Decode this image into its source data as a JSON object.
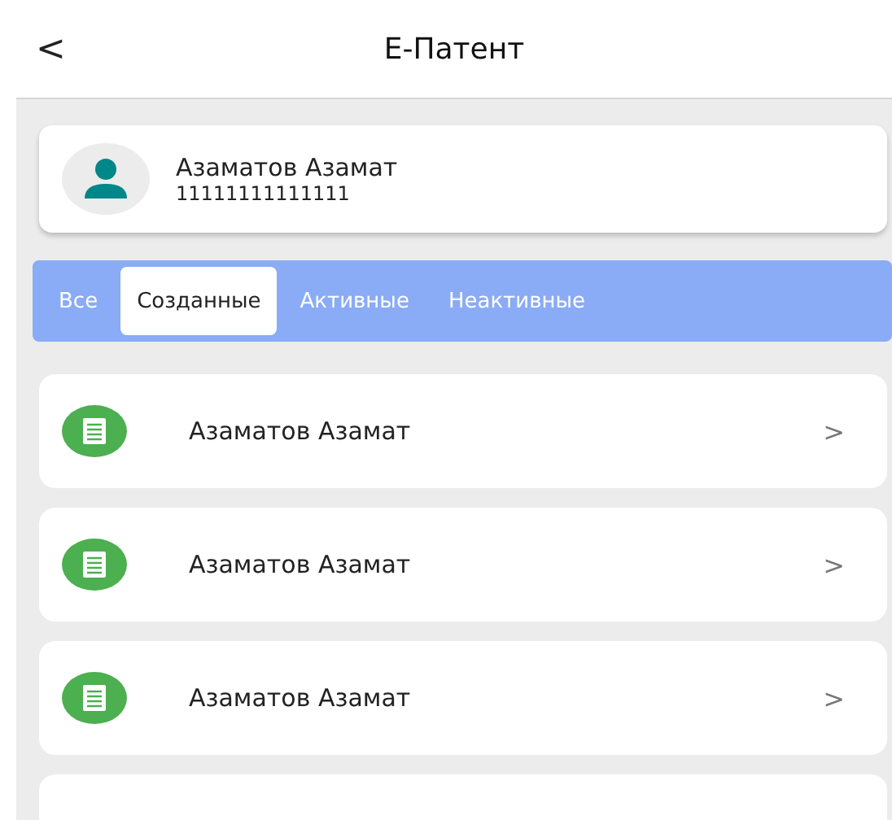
{
  "header": {
    "back": "<",
    "title": "Е-Патент"
  },
  "profile": {
    "name": "Азаматов Азамат",
    "id": "11111111111111"
  },
  "tabs": [
    {
      "label": "Все",
      "selected": false
    },
    {
      "label": "Созданные",
      "selected": true
    },
    {
      "label": "Активные",
      "selected": false
    },
    {
      "label": "Неактивные",
      "selected": false
    }
  ],
  "items": [
    {
      "name": "Азаматов Азамат",
      "chevron": ">"
    },
    {
      "name": "Азаматов Азамат",
      "chevron": ">"
    },
    {
      "name": "Азаматов Азамат",
      "chevron": ">"
    }
  ]
}
